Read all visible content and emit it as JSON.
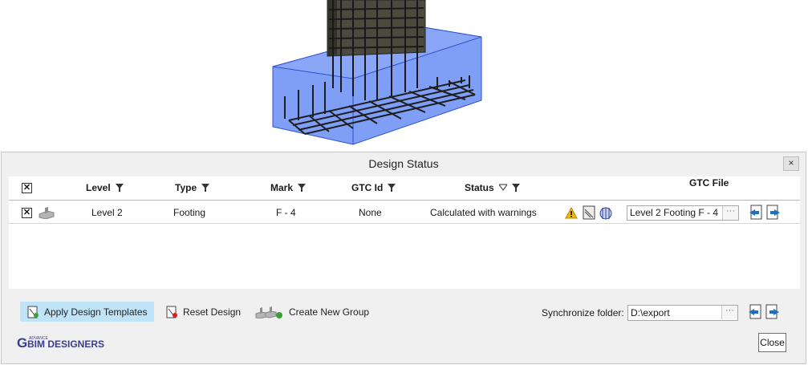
{
  "dialog": {
    "title": "Design Status",
    "close_x": "×"
  },
  "grid": {
    "columns": [
      {
        "label": "Level"
      },
      {
        "label": "Type"
      },
      {
        "label": "Mark"
      },
      {
        "label": "GTC Id"
      },
      {
        "label": "Status"
      },
      {
        "label": "GTC File"
      }
    ],
    "header_checkbox": "☒",
    "rows": [
      {
        "checkbox": "☒",
        "level": "Level 2",
        "type": "Footing",
        "mark": "F - 4",
        "gtc_id": "None",
        "status": "Calculated with warnings",
        "gtc_file": "Level 2 Footing F - 4"
      }
    ]
  },
  "toolbar": {
    "apply": "Apply Design Templates",
    "reset": "Reset Design",
    "new_group": "Create New Group"
  },
  "sync": {
    "label": "Synchronize folder:",
    "value": "D:\\export"
  },
  "logo": {
    "small": "ADVANCE",
    "main": "BIM DESIGNERS",
    "letter": "G"
  },
  "close_button": "Close",
  "colors": {
    "selected_button": "#bfe4f7",
    "footing_blue": "#7f9ef5",
    "warning": "#f2b700"
  }
}
